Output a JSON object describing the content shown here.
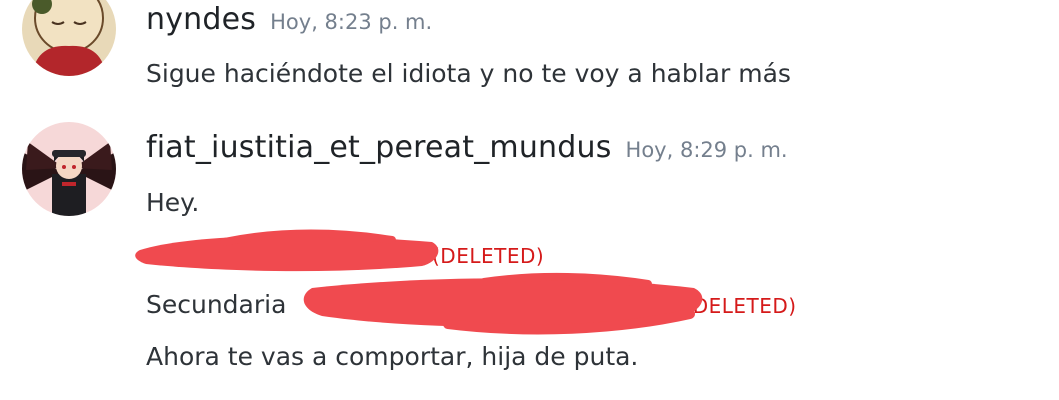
{
  "messages": [
    {
      "username": "nyndes",
      "timestamp": "Hoy, 8:23 p. m.",
      "lines": [
        "Sigue haciéndote el idiota y no te voy a hablar más"
      ]
    },
    {
      "username": "fiat_iustitia_et_pereat_mundus",
      "timestamp": "Hoy, 8:29 p. m.",
      "lines": [
        "Hey.",
        "Secundaria",
        "Ahora te vas a comportar, hija de puta."
      ],
      "deleted_labels": [
        "(DELETED)",
        "(DELETED)"
      ]
    }
  ],
  "colors": {
    "scribble": "#f04a4f",
    "deleted": "#d51a1a",
    "timestamp": "#747f8d"
  }
}
